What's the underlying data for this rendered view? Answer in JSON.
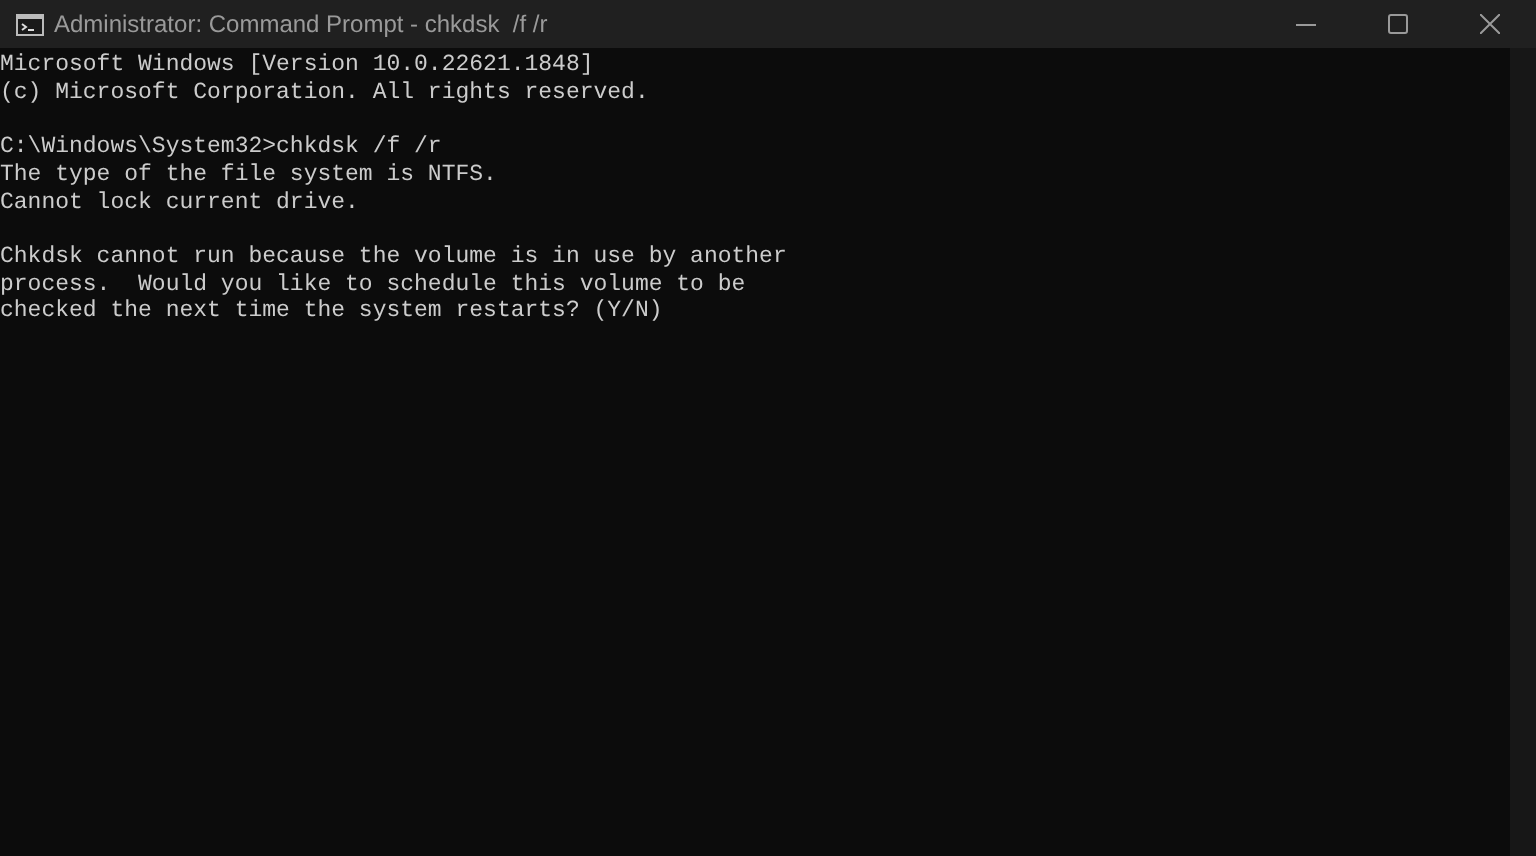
{
  "window": {
    "title": "Administrator: Command Prompt - chkdsk  /f /r"
  },
  "console": {
    "blocks": [
      [
        "Microsoft Windows [Version 10.0.22621.1848]",
        "(c) Microsoft Corporation. All rights reserved."
      ],
      [
        "C:\\Windows\\System32>chkdsk /f /r",
        "The type of the file system is NTFS.",
        "Cannot lock current drive."
      ],
      [
        "Chkdsk cannot run because the volume is in use by another",
        "process.  Would you like to schedule this volume to be",
        "checked the next time the system restarts? (Y/N)"
      ]
    ]
  }
}
